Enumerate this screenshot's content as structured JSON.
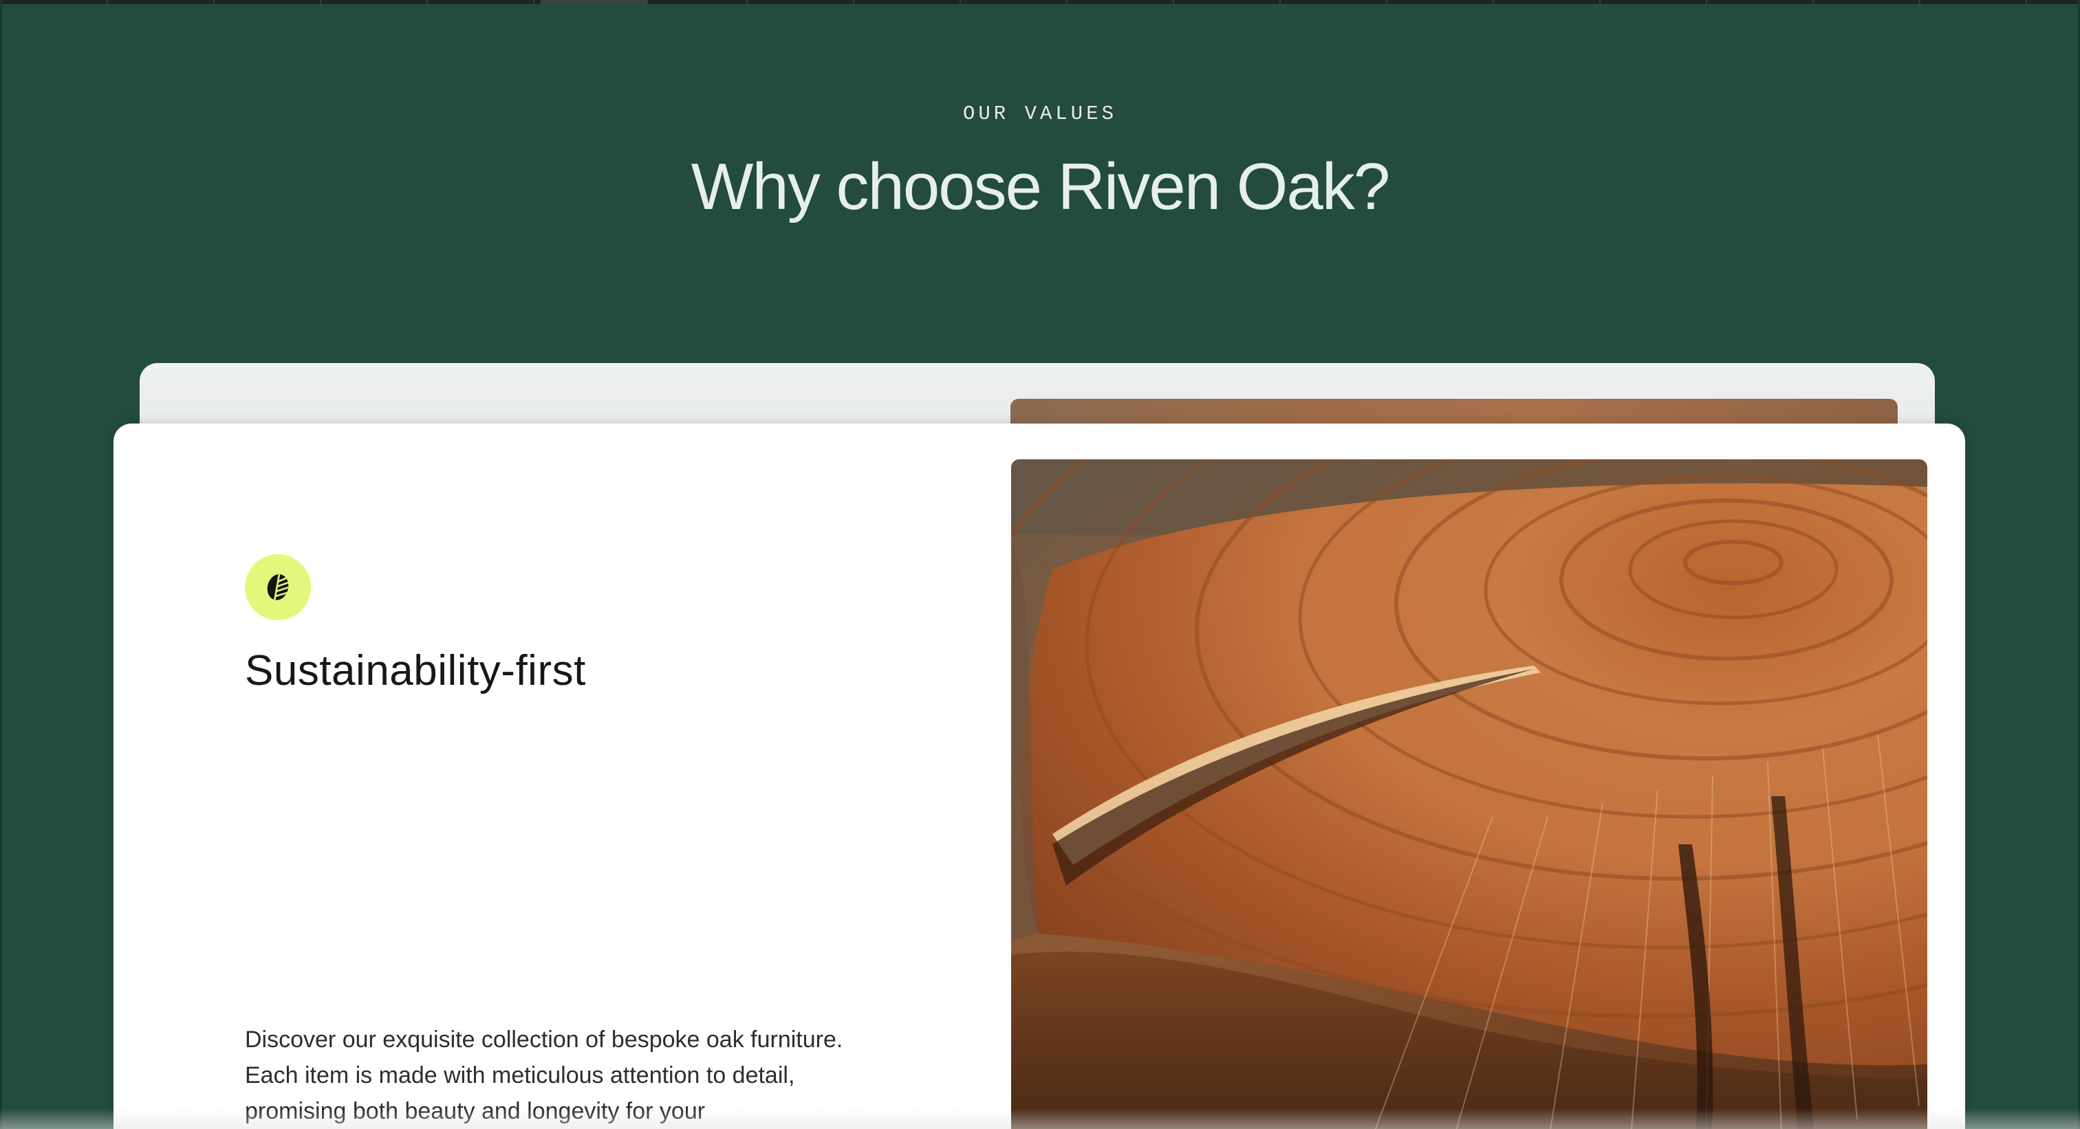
{
  "section": {
    "eyebrow": "OUR VALUES",
    "title": "Why choose Riven Oak?"
  },
  "feature_card": {
    "icon": "leaf-icon",
    "title": "Sustainability-first",
    "description": "Discover our exquisite collection of bespoke oak furniture. Each item is made with meticulous attention to detail, promising both beauty and longevity for your",
    "image": "cracked-oak-stump-photo"
  },
  "colors": {
    "background": "#234b40",
    "card": "#ffffff",
    "icon_badge": "#e4f77d",
    "heading_text": "#e7efea"
  }
}
